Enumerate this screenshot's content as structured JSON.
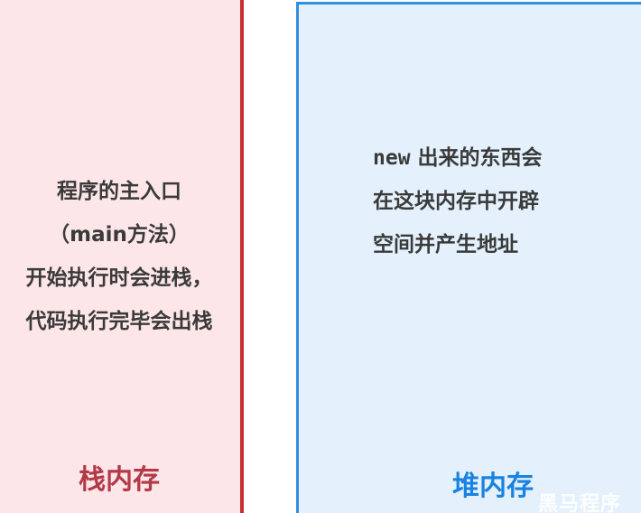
{
  "stack": {
    "description_lines": [
      "程序的主入口",
      "（main方法）",
      "开始执行时会进栈，",
      "代码执行完毕会出栈"
    ],
    "title": "栈内存",
    "colors": {
      "background": "#fde6e8",
      "border": "#c8302f",
      "title": "#b23a48"
    }
  },
  "heap": {
    "description": {
      "keyword": "new",
      "line1_rest": " 出来的东西会",
      "line2": "在这块内存中开辟",
      "line3": "空间并产生地址"
    },
    "title": "堆内存",
    "colors": {
      "background": "#e4f1fc",
      "border": "#2f8fe0",
      "title": "#1a82e0"
    }
  },
  "watermark": {
    "text": "黑马程序"
  }
}
